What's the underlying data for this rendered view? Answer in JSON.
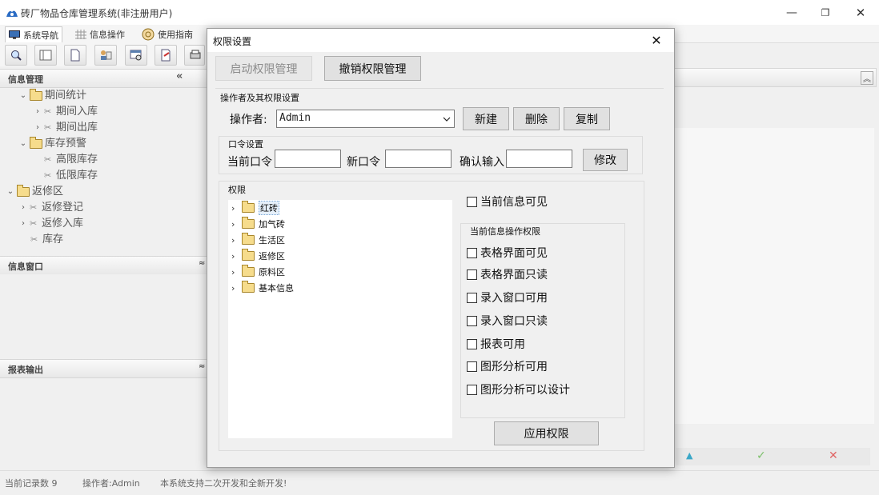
{
  "window": {
    "title": "砖厂物品仓库管理系统(非注册用户)",
    "controls": [
      "—",
      "❐",
      "✕"
    ]
  },
  "tabs": [
    {
      "label": "系统导航",
      "icon": "monitor-icon"
    },
    {
      "label": "信息操作",
      "icon": "grid-icon"
    },
    {
      "label": "使用指南",
      "icon": "compass-icon"
    }
  ],
  "left": {
    "info_mgmt_title": "信息管理",
    "collapse_glyph": "«",
    "tree": [
      {
        "label": "期间统计",
        "kind": "folder",
        "expanded": true
      },
      {
        "label": "期间入库",
        "kind": "tool"
      },
      {
        "label": "期间出库",
        "kind": "tool"
      },
      {
        "label": "库存预警",
        "kind": "folder",
        "expanded": true
      },
      {
        "label": "高限库存",
        "kind": "tool"
      },
      {
        "label": "低限库存",
        "kind": "tool"
      },
      {
        "label": "返修区",
        "kind": "folder",
        "expanded": true
      },
      {
        "label": "返修登记",
        "kind": "tool"
      },
      {
        "label": "返修入库",
        "kind": "tool"
      },
      {
        "label": "库存",
        "kind": "tool"
      }
    ],
    "info_window_title": "信息窗口",
    "report_title": "报表输出",
    "panel_collapse_glyph": "≈"
  },
  "status": {
    "record_count": "当前记录数 9",
    "operator": "操作者:Admin",
    "message": "本系统支持二次开发和全新开发!"
  },
  "dialog": {
    "title": "权限设置",
    "close": "✕",
    "start_btn": "启动权限管理",
    "revoke_btn": "撤销权限管理",
    "operator_group": "操作者及其权限设置",
    "operator_label": "操作者:",
    "operator_value": "Admin",
    "new_btn": "新建",
    "delete_btn": "删除",
    "copy_btn": "复制",
    "password_group": "口令设置",
    "current_pw_label": "当前口令",
    "new_pw_label": "新口令",
    "confirm_pw_label": "确认输入",
    "modify_btn": "修改",
    "perm_group": "权限",
    "perm_tree": [
      "红砖",
      "加气砖",
      "生活区",
      "返修区",
      "原料区",
      "基本信息"
    ],
    "info_visible": "当前信息可见",
    "ops_group": "当前信息操作权限",
    "ops": [
      "表格界面可见",
      "表格界面只读",
      "录入窗口可用",
      "录入窗口只读",
      "报表可用",
      "图形分析可用",
      "图形分析可以设计"
    ],
    "apply_btn": "应用权限"
  },
  "colors": {
    "accent": "#1a73c8",
    "folder": "#f6dc8c"
  }
}
